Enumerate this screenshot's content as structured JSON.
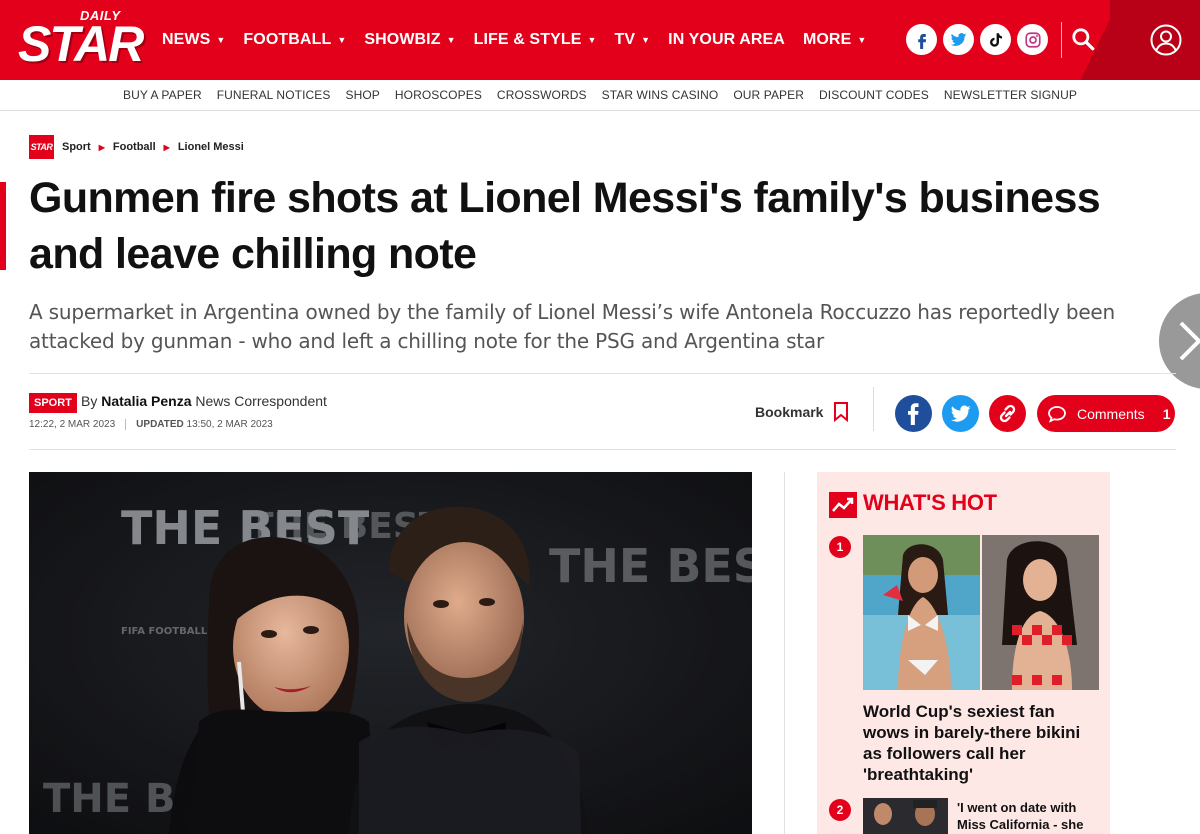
{
  "header": {
    "logo_top": "DAILY",
    "logo_main": "STAR",
    "nav": [
      {
        "label": "NEWS",
        "has_dropdown": true
      },
      {
        "label": "FOOTBALL",
        "has_dropdown": true
      },
      {
        "label": "SHOWBIZ",
        "has_dropdown": true
      },
      {
        "label": "LIFE & STYLE",
        "has_dropdown": true
      },
      {
        "label": "TV",
        "has_dropdown": true
      },
      {
        "label": "IN YOUR AREA",
        "has_dropdown": false
      },
      {
        "label": "MORE",
        "has_dropdown": true
      }
    ],
    "social_icons": [
      "facebook-icon",
      "twitter-icon",
      "tiktok-icon",
      "instagram-icon"
    ],
    "brand_color": "#e3001b"
  },
  "subnav": [
    "BUY A PAPER",
    "FUNERAL NOTICES",
    "SHOP",
    "HOROSCOPES",
    "CROSSWORDS",
    "STAR WINS CASINO",
    "OUR PAPER",
    "DISCOUNT CODES",
    "NEWSLETTER SIGNUP"
  ],
  "breadcrumb": {
    "logo_text": "STAR",
    "items": [
      "Sport",
      "Football",
      "Lionel Messi"
    ]
  },
  "article": {
    "headline": "Gunmen fire shots at Lionel Messi's family's business and leave chilling note",
    "standfirst": "A supermarket in Argentina owned by the family of Lionel Messi’s wife Antonela Roccuzzo has reportedly been attacked by gunman - who and left a chilling note for the PSG and Argentina star",
    "section_badge": "SPORT",
    "by": "By",
    "author": "Natalia Penza",
    "author_role": "News Correspondent",
    "published": "12:22, 2 MAR 2023",
    "updated_label": "UPDATED",
    "updated": "13:50, 2 MAR 2023",
    "bookmark_label": "Bookmark",
    "comments_label": "Comments",
    "comments_count": "1"
  },
  "hero_image": {
    "backdrop_text": [
      "THE BEST",
      "THE BEST",
      "THE BEST",
      "THE BEST"
    ],
    "sponsor_text": "FIFA FOOTBALL AWARDS"
  },
  "whats_hot": {
    "title": "WHAT'S HOT",
    "stories": [
      {
        "rank": "1",
        "title": "World Cup's sexiest fan wows in barely-there bikini as followers call her 'breathtaking'"
      },
      {
        "rank": "2",
        "title": "'I went on date with Miss California - she"
      }
    ]
  }
}
